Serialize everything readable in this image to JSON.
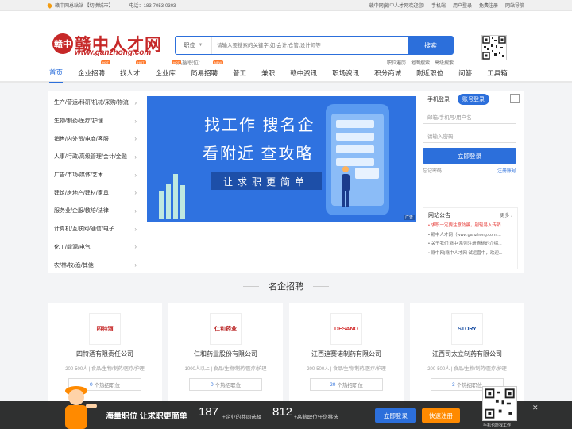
{
  "topbar": {
    "location": "赣中网总站站 【切换城市】",
    "phone": "电话：183-7053-0303",
    "welcome": "赣中网|赣中人才网欢迎您!",
    "links": [
      "手机端",
      "用户登录",
      "免费注册",
      "网站导航"
    ]
  },
  "logo": {
    "mark": "赣中",
    "name": "赣中人才网",
    "domain": "www.ganzhong.com"
  },
  "search": {
    "select_label": "职位",
    "placeholder": "请输入要搜索的关键字,如:会计,仓管,设计师等",
    "button": "搜索"
  },
  "hot_label": "热搜职位:",
  "sublinks": [
    "职位遍历",
    "地图搜索",
    "高级搜索"
  ],
  "nav": [
    {
      "label": "首页",
      "active": true,
      "tag": ""
    },
    {
      "label": "企业招聘",
      "tag": "HOT"
    },
    {
      "label": "找人才",
      "tag": "HOT"
    },
    {
      "label": "企业库",
      "tag": "HOT"
    },
    {
      "label": "简易招聘",
      "tag": "NEW"
    },
    {
      "label": "普工",
      "tag": ""
    },
    {
      "label": "兼职",
      "tag": ""
    },
    {
      "label": "赣中资讯",
      "tag": ""
    },
    {
      "label": "职场资讯",
      "tag": ""
    },
    {
      "label": "积分商城",
      "tag": ""
    },
    {
      "label": "附近职位",
      "tag": ""
    },
    {
      "label": "问答",
      "tag": ""
    },
    {
      "label": "工具箱",
      "tag": ""
    }
  ],
  "categories": [
    "生产/营运/科研/机械/采购/物流",
    "生物/制药/医疗/护理",
    "销售/内外贸/电商/客服",
    "人事/行政/高级管理/会计/金融",
    "广告/市场/媒体/艺术",
    "建筑/房地产/建材/家具",
    "服务业/企服/教培/法律",
    "计算机/互联网/通信/电子",
    "化工/能源/电气",
    "农/林/牧/渔/其他"
  ],
  "banner": {
    "line1": "找工作 搜名企",
    "line2": "看附近 查攻略",
    "line3": "让求职更简单",
    "ad": "广告"
  },
  "login": {
    "tab_mobile": "手机登录",
    "tab_account": "账号登录",
    "user_placeholder": "邮箱/手机号/用户名",
    "pass_placeholder": "请输入密码",
    "submit": "立即登录",
    "forgot": "忘记密码",
    "register": "注册账号"
  },
  "notice": {
    "title": "网站公告",
    "more": "更多",
    "items": [
      "求职一定要注意防骗，别轻易入传销...",
      "赣中人才网（www.ganzhong.com ...",
      "关于我们'赣中'系列注册商标的介绍...",
      "赣中网|赣中人才网 试运营中，欢迎..."
    ]
  },
  "section_title": "名企招聘",
  "companies": [
    {
      "logo": "四特酒",
      "name": "四特酒有限责任公司",
      "info": "200-500人 | 食品/生物/制药/医疗/护理",
      "jobs": "0",
      "jobs_label": "个热招职位"
    },
    {
      "logo": "仁和药业",
      "name": "仁和药业股份有限公司",
      "info": "1000人以上 | 食品/生物/制药/医疗/护理",
      "jobs": "0",
      "jobs_label": "个热招职位"
    },
    {
      "logo": "DESANO",
      "name": "江西迪赛诺制药有限公司",
      "info": "200-500人 | 食品/生物/制药/医疗/护理",
      "jobs": "20",
      "jobs_label": "个热招职位"
    },
    {
      "logo": "STORY",
      "name": "江西司太立制药有限公司",
      "info": "200-500人 | 食品/生物/制药/医疗/护理",
      "jobs": "3",
      "jobs_label": "个热招职位"
    }
  ],
  "footbar": {
    "slogan": "海量职位 让求职更简单",
    "companies_count": "187",
    "companies_label": "+企业的共同选择",
    "jobs_count": "812",
    "jobs_label": "+高薪职位任您挑选",
    "login": "立即登录",
    "register": "快速注册",
    "qr_caption": "手机也能找工作",
    "close": "✕"
  },
  "colors": {
    "brand_blue": "#2c6fdb",
    "logo_red": "#c62828",
    "orange": "#ff8a00"
  }
}
